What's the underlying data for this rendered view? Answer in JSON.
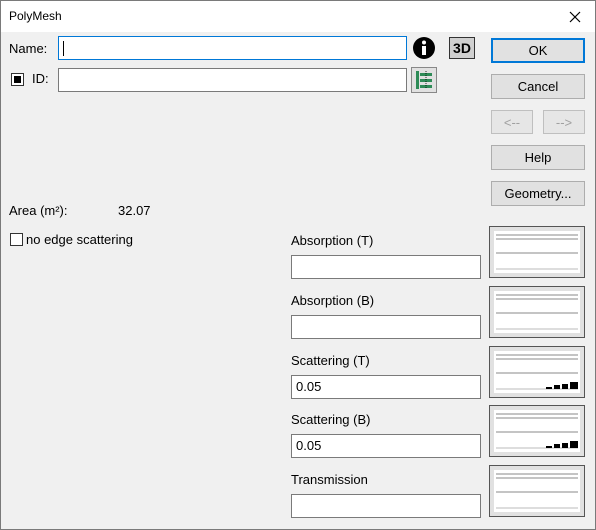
{
  "window": {
    "title": "PolyMesh"
  },
  "name_field": {
    "label": "Name:",
    "value": ""
  },
  "id_field": {
    "label": "ID:",
    "value": "",
    "checked": true
  },
  "buttons": {
    "ok": "OK",
    "cancel": "Cancel",
    "prev": "<--",
    "next": "-->",
    "help": "Help",
    "geometry": "Geometry...",
    "three_d": "3D"
  },
  "area": {
    "label": "Area (m²):",
    "value": "32.07"
  },
  "edge_scattering": {
    "label": "no edge scattering",
    "checked": false
  },
  "properties": [
    {
      "label": "Absorption (T)",
      "value": "",
      "chart": "empty"
    },
    {
      "label": "Absorption (B)",
      "value": "",
      "chart": "empty"
    },
    {
      "label": "Scattering (T)",
      "value": "0.05",
      "chart": "bars"
    },
    {
      "label": "Scattering (B)",
      "value": "0.05",
      "chart": "bars"
    },
    {
      "label": "Transmission",
      "value": "",
      "chart": "empty"
    }
  ],
  "colors": {
    "accent": "#0078d7",
    "info_icon": "#000000",
    "id_icon": "#2e8b57"
  },
  "icons": {
    "info": "info-icon",
    "three_d": "3d-icon",
    "id_list": "id-list-icon",
    "close": "close-icon"
  }
}
